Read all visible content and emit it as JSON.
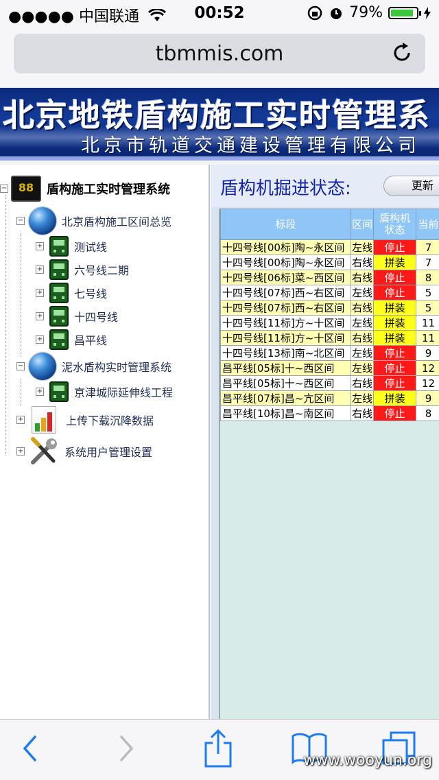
{
  "status_bar": {
    "carrier": "●●●●● 中国联通",
    "time": "00:52",
    "battery": "79%",
    "battery_level": 0.79
  },
  "browser": {
    "url": "tbmmis.com"
  },
  "banner": {
    "title": "北京地铁盾构施工实时管理系",
    "subtitle": "北京市轨道交通建设管理有限公司"
  },
  "tree": {
    "root": "盾构施工实时管理系统",
    "monitor_text": "88",
    "group1": "北京盾构施工区间总览",
    "lines1": [
      "测试线",
      "六号线二期",
      "七号线",
      "十四号线",
      "昌平线"
    ],
    "group2": "泥水盾构实时管理系统",
    "lines2": [
      "京津城际延伸线工程"
    ],
    "upload": "上传下载沉降数据",
    "settings": "系统用户管理设置"
  },
  "panel": {
    "title": "盾构机掘进状态:",
    "refresh": "更新",
    "headers": [
      "标段",
      "区间",
      "盾构机状态",
      "当前"
    ],
    "rows": [
      {
        "seg": "十四号线[00标]陶~永区间",
        "side": "左线",
        "status": "停止",
        "cur": "7"
      },
      {
        "seg": "十四号线[00标]陶~永区间",
        "side": "右线",
        "status": "拼装",
        "cur": "7"
      },
      {
        "seg": "十四号线[06标]菜~西区间",
        "side": "右线",
        "status": "停止",
        "cur": "8"
      },
      {
        "seg": "十四号线[07标]西~右区间",
        "side": "左线",
        "status": "停止",
        "cur": "5"
      },
      {
        "seg": "十四号线[07标]西~右区间",
        "side": "右线",
        "status": "拼装",
        "cur": "5"
      },
      {
        "seg": "十四号线[11标]方~十区间",
        "side": "左线",
        "status": "拼装",
        "cur": "11"
      },
      {
        "seg": "十四号线[11标]方~十区间",
        "side": "右线",
        "status": "拼装",
        "cur": "11"
      },
      {
        "seg": "十四号线[13标]南~北区间",
        "side": "左线",
        "status": "停止",
        "cur": "9"
      },
      {
        "seg": "昌平线[05标]十~西区间",
        "side": "左线",
        "status": "停止",
        "cur": "12"
      },
      {
        "seg": "昌平线[05标]十~西区间",
        "side": "右线",
        "status": "停止",
        "cur": "12"
      },
      {
        "seg": "昌平线[07标]昌~亢区间",
        "side": "左线",
        "status": "拼装",
        "cur": "9"
      },
      {
        "seg": "昌平线[10标]昌~南区间",
        "side": "右线",
        "status": "停止",
        "cur": "8"
      }
    ]
  },
  "watermark": "www.wooyun.org",
  "colors": {
    "banner": "#0d2e84",
    "header": "#8fc6f7",
    "stop": "#ff1a1a",
    "assemble": "#ffff1a",
    "row_odd": "#ffffb3",
    "row_even": "#ffffff",
    "ios_blue": "#1a7cf0"
  }
}
